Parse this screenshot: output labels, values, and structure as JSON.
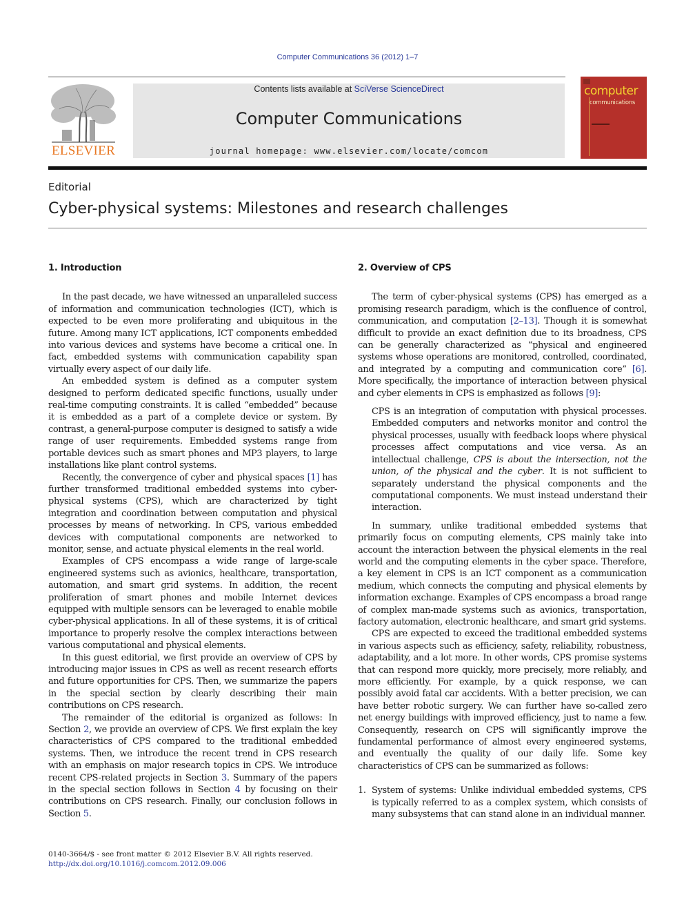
{
  "header": {
    "running_head": "Computer Communications 36 (2012) 1–7",
    "publisher_logo_text": "ELSEVIER",
    "contents_prefix": "Contents lists available at ",
    "contents_link": "SciVerse ScienceDirect",
    "journal_title": "Computer Communications",
    "homepage_prefix": "journal homepage: ",
    "homepage_url": "www.elsevier.com/locate/comcom",
    "cover": {
      "title_line1": "computer",
      "title_line2": "communications"
    }
  },
  "colors": {
    "link": "#2a3a9a",
    "elsevier_orange": "#e87722",
    "cover_red": "#b5302a",
    "cover_yellow": "#f2d230",
    "masthead_gray": "#e6e6e6"
  },
  "article": {
    "type": "Editorial",
    "title": "Cyber-physical systems: Milestones and research challenges"
  },
  "sections": {
    "intro": {
      "heading": "1.  Introduction",
      "p1": "In the past decade, we have witnessed an unparalleled success of information and communication technologies (ICT), which is expected to be even more proliferating and ubiquitous in the future. Among many ICT applications, ICT components embedded into various devices and systems have become a critical one. In fact, embedded systems with communication capability span virtually every aspect of our daily life.",
      "p2": "An embedded system is defined as a computer system designed to perform dedicated specific functions, usually under real-time computing constraints. It is called “embedded” because it is embedded as a part of a complete device or system. By contrast, a general-purpose computer is designed to satisfy a wide range of user requirements. Embedded systems range from portable devices such as smart phones and MP3 players, to large installations like plant control systems.",
      "p3_a": "Recently, the convergence of cyber and physical spaces ",
      "p3_ref": "[1]",
      "p3_b": " has further transformed traditional embedded systems into cyber-physical systems (CPS), which are characterized by tight integration and coordination between computation and physical processes by means of networking. In CPS, various embedded devices with computational components are networked to monitor, sense, and actuate physical elements in the real world.",
      "p4": "Examples of CPS encompass a wide range of large-scale engineered systems such as avionics, healthcare, transportation, automation, and smart grid systems. In addition, the recent proliferation of smart phones and mobile Internet devices equipped with multiple sensors can be leveraged to enable mobile cyber-physical applications. In all of these systems, it is of critical importance to properly resolve the complex interactions between various computational and physical elements.",
      "p5": "In this guest editorial, we first provide an overview of CPS by introducing major issues in CPS as well as recent research efforts and future opportunities for CPS. Then, we summarize the papers in the special section by clearly describing their main contributions on CPS research.",
      "p6_a": "The remainder of the editorial is organized as follows: In Section ",
      "p6_ref1": "2",
      "p6_b": ", we provide an overview of CPS. We first explain the key characteristics of CPS compared to the traditional embedded systems. Then, we introduce the recent trend in CPS research with an emphasis on major research topics in CPS. We introduce recent CPS-related projects in Section ",
      "p6_ref2": "3",
      "p6_c": ". Summary of the papers in the special section follows in Section ",
      "p6_ref3": "4",
      "p6_d": " by focusing on their contributions on CPS research. Finally, our conclusion follows in Section ",
      "p6_ref4": "5",
      "p6_e": "."
    },
    "overview": {
      "heading": "2.  Overview of CPS",
      "p1_a": "The term of cyber-physical systems (CPS) has emerged as a promising research paradigm, which is the confluence of control, communication, and computation ",
      "p1_ref1": "[2–13]",
      "p1_b": ". Though it is somewhat difficult to provide an exact definition due to its broadness, CPS can be generally characterized as “physical and engineered systems whose operations are monitored, controlled, coordinated, and integrated by a computing and communication core” ",
      "p1_ref2": "[6]",
      "p1_c": ". More specifically, the importance of interaction between physical and cyber elements in CPS is emphasized as follows ",
      "p1_ref3": "[9]",
      "p1_d": ":",
      "quote_a": "CPS is an integration of computation with physical processes. Embedded computers and networks monitor and control the physical processes, usually with feedback loops where physical processes affect computations and vice versa. As an intellectual challenge, ",
      "quote_em": "CPS is about the intersection, not the union, of the physical and the cyber",
      "quote_b": ". It is not sufficient to separately understand the physical components and the computational components. We must instead understand their interaction.",
      "p2": "In summary, unlike traditional embedded systems that primarily focus on computing elements, CPS mainly take into account the interaction between the physical elements in the real world and the computing elements in the cyber space. Therefore, a key element in CPS is an ICT component as a communication medium, which connects the computing and physical elements by information exchange. Examples of CPS encompass a broad range of complex man-made systems such as avionics, transportation, factory automation, electronic healthcare, and smart grid systems.",
      "p3": "CPS are expected to exceed the traditional embedded systems in various aspects such as efficiency, safety, reliability, robustness, adaptability, and a lot more. In other words, CPS promise systems that can respond more quickly, more precisely, more reliably, and more efficiently. For example, by a quick response, we can possibly avoid fatal car accidents. With a better precision, we can have better robotic surgery. We can further have so-called zero net energy buildings with improved efficiency, just to name a few. Consequently, research on CPS will significantly improve the fundamental performance of almost every engineered systems, and eventually the quality of our daily life. Some key characteristics of CPS can be summarized as follows:",
      "list": [
        {
          "num": "1.",
          "text": "System of systems: Unlike individual embedded systems, CPS is typically referred to as a complex system, which consists of many subsystems that can stand alone in an individual manner."
        }
      ]
    }
  },
  "footer": {
    "copyright": "0140-3664/$ - see front matter © 2012 Elsevier B.V. All rights reserved.",
    "doi": "http://dx.doi.org/10.1016/j.comcom.2012.09.006"
  }
}
